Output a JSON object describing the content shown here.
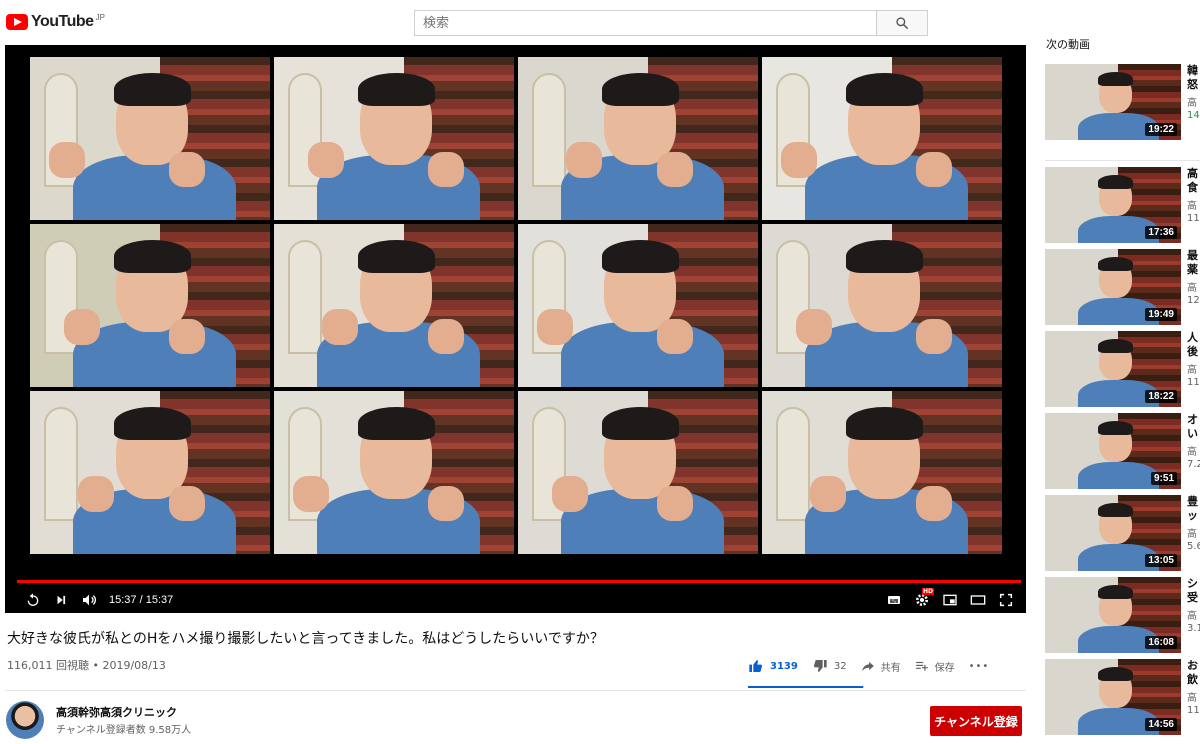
{
  "header": {
    "logo_text": "YouTube",
    "logo_region": "JP",
    "search_placeholder": "検索",
    "search_icon": "search-icon"
  },
  "player": {
    "time_current": "15:37",
    "time_separator": " / ",
    "time_total": "15:37",
    "progress_fraction": 1.0,
    "accent_color": "#ff0000",
    "controls_left": [
      "replay-icon",
      "next-icon",
      "volume-icon"
    ],
    "controls_right": [
      "subtitles-icon",
      "settings-hd-icon",
      "miniplayer-icon",
      "theater-icon",
      "fullscreen-icon"
    ],
    "hd_badge": "HD"
  },
  "video": {
    "title": "大好きな彼氏が私とのHをハメ撮り撮影したいと言ってきました。私はどうしたらいいですか？",
    "views": "116,011 回視聴",
    "date_separator": " • ",
    "date": "2019/08/13",
    "likes": "3139",
    "dislikes": "32",
    "like_fraction": 0.99,
    "share_label": "共有",
    "save_label": "保存",
    "more_label": "•••"
  },
  "channel": {
    "name": "高須幹弥高須クリニック",
    "subscribers": "チャンネル登録者数 9.58万人",
    "subscribe_label": "チャンネル登録",
    "subscribe_color": "#cc0000"
  },
  "sidebar": {
    "up_next_label": "次の動画",
    "items": [
      {
        "title": "韓 怒",
        "channel": "高",
        "views": "14",
        "views_new": true,
        "duration": "19:22"
      },
      {
        "title": "高 食",
        "channel": "高",
        "views": "11",
        "views_new": false,
        "duration": "17:36"
      },
      {
        "title": "最 薬",
        "channel": "高",
        "views": "12",
        "views_new": false,
        "duration": "19:49"
      },
      {
        "title": "人 後",
        "channel": "高",
        "views": "11",
        "views_new": false,
        "duration": "18:22"
      },
      {
        "title": "オ い",
        "channel": "高",
        "views": "7.2",
        "views_new": false,
        "duration": "9:51"
      },
      {
        "title": "豊 ッ",
        "channel": "高",
        "views": "5.6",
        "views_new": false,
        "duration": "13:05"
      },
      {
        "title": "シ 受",
        "channel": "高",
        "views": "3.1",
        "views_new": false,
        "duration": "16:08"
      },
      {
        "title": "お 飲",
        "channel": "高",
        "views": "11",
        "views_new": false,
        "duration": "14:56"
      }
    ]
  }
}
